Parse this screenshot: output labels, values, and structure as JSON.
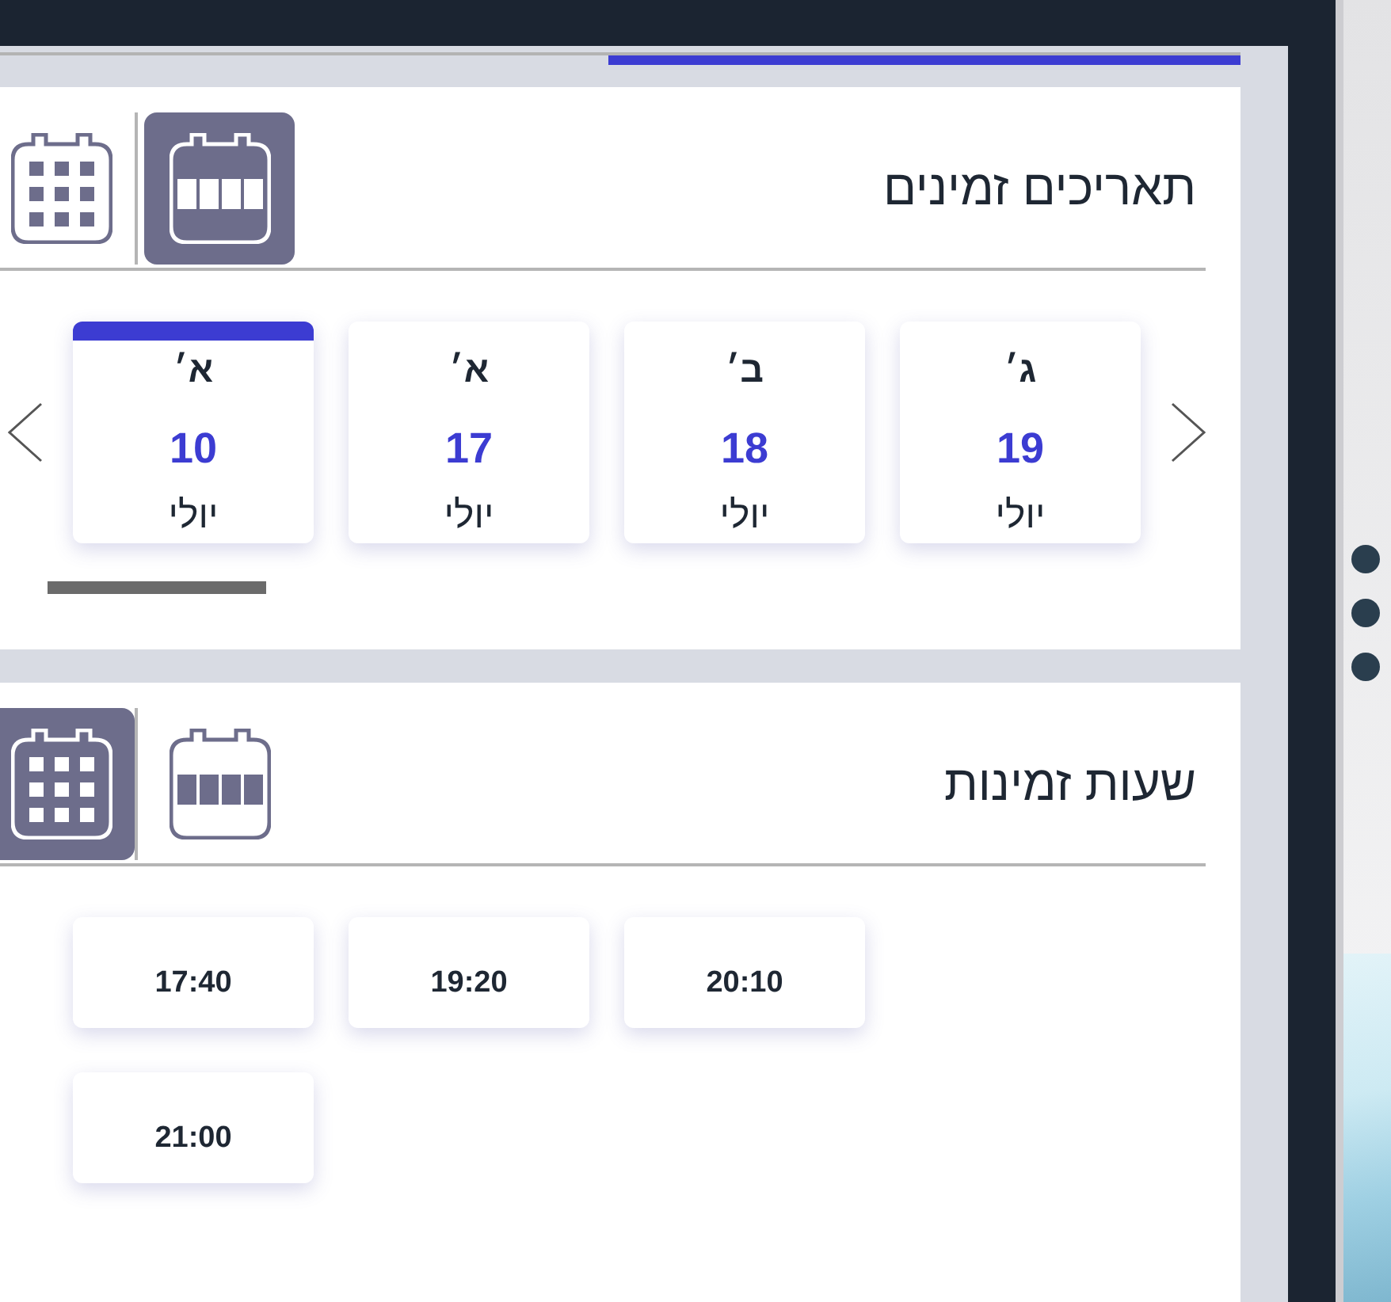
{
  "progress": {
    "level": 0.51
  },
  "available_dates": {
    "title": "תאריכים זמינים",
    "view_modes": [
      {
        "kind": "grid",
        "selected": false
      },
      {
        "kind": "week",
        "selected": true
      }
    ],
    "dates": [
      {
        "day": "ג׳",
        "date": "19",
        "month": "יולי",
        "selected": false
      },
      {
        "day": "ב׳",
        "date": "18",
        "month": "יולי",
        "selected": false
      },
      {
        "day": "א׳",
        "date": "17",
        "month": "יולי",
        "selected": false
      },
      {
        "day": "א׳",
        "date": "10",
        "month": "יולי",
        "selected": true
      }
    ]
  },
  "available_hours": {
    "title": "שעות זמינות",
    "view_modes": [
      {
        "kind": "grid",
        "selected": true
      },
      {
        "kind": "week",
        "selected": false
      }
    ],
    "slots": [
      "20:10",
      "19:20",
      "17:40",
      "21:00"
    ]
  }
}
